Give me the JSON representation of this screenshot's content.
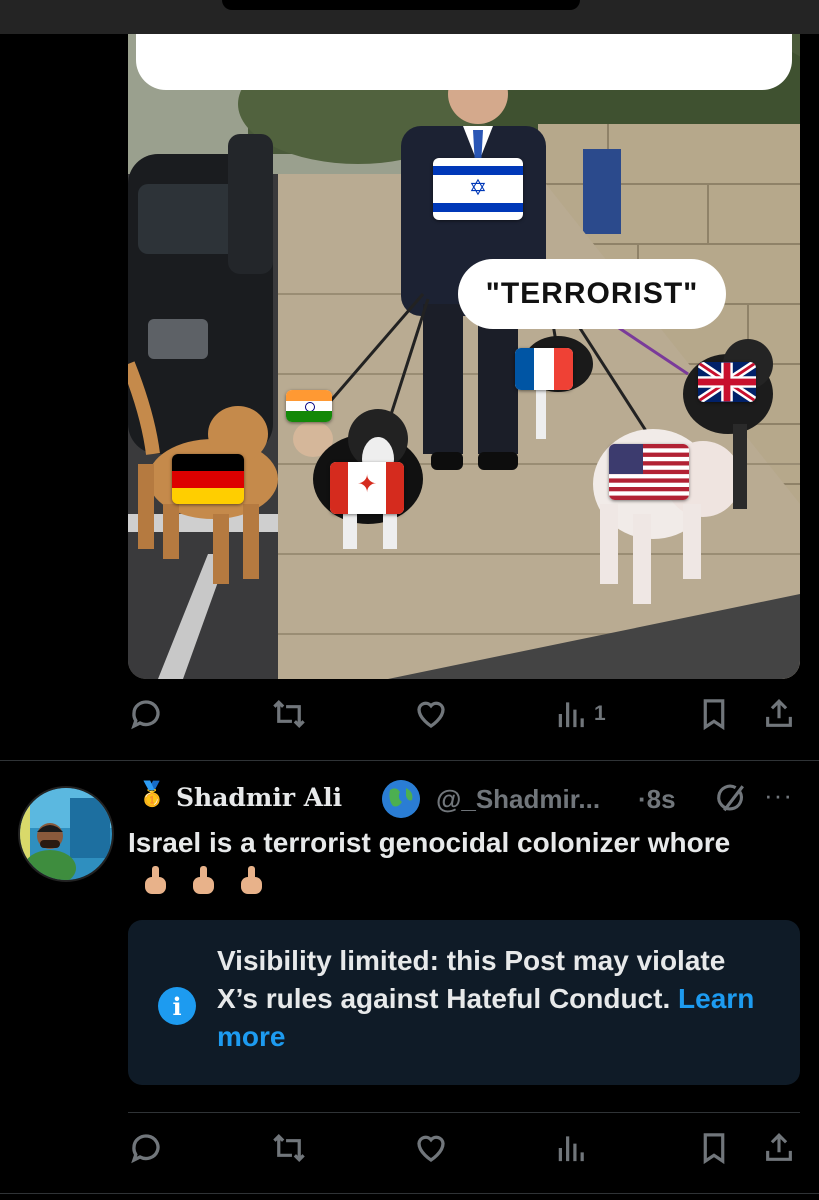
{
  "media": {
    "caption_label": "\"TERRORIST\"",
    "flags": [
      "israel-flag",
      "india-flag",
      "france-flag",
      "uk-flag",
      "germany-flag",
      "canada-flag",
      "usa-flag"
    ]
  },
  "first_post_actions": {
    "reply_icon": "reply-icon",
    "repost_icon": "repost-icon",
    "like_icon": "like-icon",
    "views_icon": "views-icon",
    "views_count": "1",
    "bookmark_icon": "bookmark-icon",
    "share_icon": "share-icon"
  },
  "reply": {
    "badge": "🥇",
    "display_name": "Shadmir Ali",
    "globe": "🌍",
    "handle": "@_Shadmir...",
    "timestamp": "·8s",
    "text": "Israel is a terrorist genocidal colonizer whore",
    "text_emojis": [
      "middle-finger-icon",
      "middle-finger-icon",
      "middle-finger-icon"
    ],
    "more": "···"
  },
  "notice": {
    "message": "Visibility limited: this Post may violate X’s rules against Hateful Conduct.",
    "link": "Learn more"
  },
  "colors": {
    "background": "#000000",
    "text": "#e7e9ea",
    "muted": "#71767b",
    "accent": "#1d9bf0",
    "notice_bg": "#0f1b27"
  }
}
